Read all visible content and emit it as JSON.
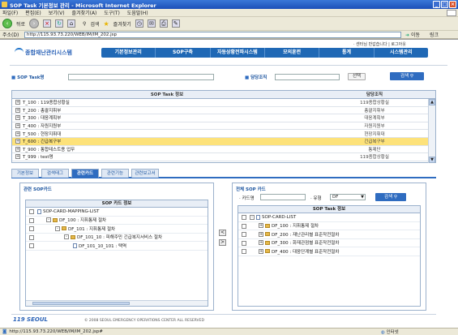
{
  "window": {
    "title": "SOP Task 기본정보 관리 - Microsoft Internet Explorer"
  },
  "menu": [
    "파일(F)",
    "편집(E)",
    "보기(V)",
    "즐겨찾기(A)",
    "도구(T)",
    "도움말(H)"
  ],
  "toolbar": {
    "back": "뒤로",
    "search": "검색",
    "favorites": "즐겨찾기"
  },
  "address": {
    "label": "주소(D)",
    "url": "http://115.93.73.220/WEB/IM/IM_202.jsp",
    "go": "이동",
    "links": "링크"
  },
  "header": {
    "top_links": "· 센터님 반갑습니다 | 로그아웃",
    "logo": "종합재난관리시스템",
    "nav": [
      "기본정보관리",
      "SOP구축",
      "자동상황전파시스템",
      "모의훈련",
      "통계",
      "시스템관리"
    ]
  },
  "search": {
    "task_label": "SOP Task명",
    "org_label": "담당조직",
    "select_btn": "선택",
    "search_btn": "검색"
  },
  "task_table": {
    "headers": [
      "SOP Task 정보",
      "담당조직"
    ],
    "rows": [
      {
        "name": "T_100 : 119종합상황실",
        "org": "119종합상황실",
        "selected": false
      },
      {
        "name": "T_200 : 총괄지휘부",
        "org": "총괄지휘부",
        "selected": false
      },
      {
        "name": "T_300 : 대응계획부",
        "org": "대응계획부",
        "selected": false
      },
      {
        "name": "T_400 : 자원지원부",
        "org": "자원지원부",
        "selected": false
      },
      {
        "name": "T_500 : 현장지휘대",
        "org": "현장지휘대",
        "selected": false
      },
      {
        "name": "T_600 : 긴급복구부",
        "org": "긴급복구부",
        "selected": true
      },
      {
        "name": "T_900 : 통합테스트용 업무",
        "org": "통제단",
        "selected": false
      },
      {
        "name": "T_999 : test명",
        "org": "119종합상황실",
        "selected": false
      }
    ]
  },
  "tabs": [
    {
      "label": "기본정보",
      "active": false
    },
    {
      "label": "검색태그",
      "active": false
    },
    {
      "label": "관련카드",
      "active": true
    },
    {
      "label": "관련기능",
      "active": false
    },
    {
      "label": "관련보고서",
      "active": false
    }
  ],
  "left_panel": {
    "title": "관련 SOP카드",
    "inner_header": "SOP 카드 정보",
    "tree": [
      {
        "label": "SOP-CARD-MAPPING-LIST",
        "level": 0,
        "sign": "",
        "icon": "doc"
      },
      {
        "label": "DF_100 : 지휘통제 절차",
        "level": 1,
        "sign": "-",
        "icon": "folder"
      },
      {
        "label": "DF_101 : 지휘통제 절차",
        "level": 2,
        "sign": "-",
        "icon": "folder"
      },
      {
        "label": "DF_101_10 : 피해주민 긴급복지서비스 절차",
        "level": 3,
        "sign": "-",
        "icon": "folder"
      },
      {
        "label": "DF_101_10_101 : 택역",
        "level": 4,
        "sign": "",
        "icon": "doc"
      }
    ]
  },
  "right_panel": {
    "title": "전체 SOP 카드",
    "card_label": "· 카드명",
    "type_label": "· 유형",
    "type_value": "DF",
    "search_btn": "검색",
    "inner_header": "SOP Task 정보",
    "tree": [
      {
        "label": "SOP-CARD-LIST",
        "level": 0,
        "sign": "-",
        "icon": "doc"
      },
      {
        "label": "DF_100 : 지휘통제 절차",
        "level": 1,
        "sign": "+",
        "icon": "folder"
      },
      {
        "label": "DF_200 : 재난관리별 표준작전절차",
        "level": 1,
        "sign": "+",
        "icon": "folder"
      },
      {
        "label": "DF_300 : 화재관점별 표준작전절차",
        "level": 1,
        "sign": "+",
        "icon": "folder"
      },
      {
        "label": "DF_400 : 대응단계별 표준작전절차",
        "level": 1,
        "sign": "+",
        "icon": "folder"
      }
    ]
  },
  "transfer": {
    "left_arrow": "<",
    "right_arrow": ">"
  },
  "footer": {
    "logo": "119 SEOUL",
    "copyright": "© 2008 SEOUL EMERGENCY OPERATIONS CENTER ALL RESERVED"
  },
  "status": {
    "text": "http://115.93.73.220/WEB/IM/IM_202.jsp#",
    "zone": "인터넷"
  },
  "colors": {
    "nav_blue": "#1f68b5",
    "selected_row": "#fde27a",
    "active_tab": "#2f6cc0"
  }
}
